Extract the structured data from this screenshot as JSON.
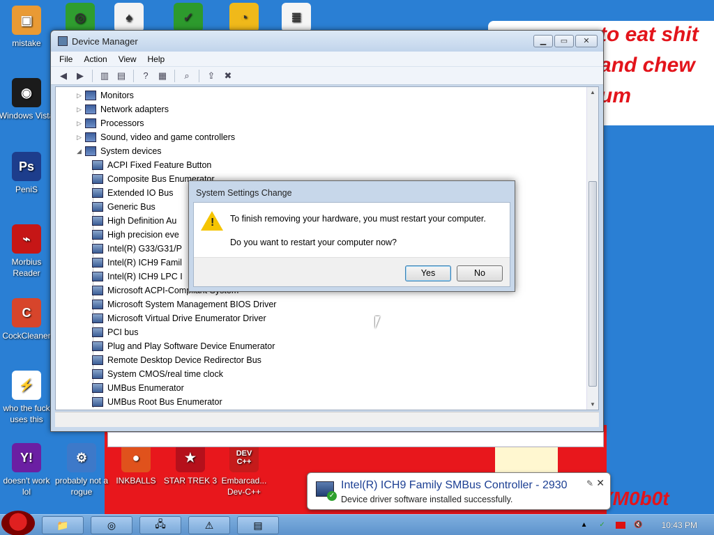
{
  "wallpaper": {
    "graffiti_top": [
      "to eat shit",
      "and chew",
      "um"
    ],
    "graffiti_bottom": "YM0b0t"
  },
  "desktop_icons": [
    {
      "label": "mistake",
      "color": "#e99a34",
      "glyph": "▣"
    },
    {
      "label": "Windows Vista",
      "color": "#1b1b1b",
      "glyph": "◉"
    },
    {
      "label": "PeniS",
      "color": "#1d3d8c",
      "glyph": "Ps"
    },
    {
      "label": "Morbius Reader",
      "color": "#c61616",
      "glyph": "⌁"
    },
    {
      "label": "CockCleaner",
      "color": "#d7452b",
      "glyph": "C"
    },
    {
      "label": "who the fuck uses this",
      "color": "#ffffff",
      "glyph": "⚡"
    },
    {
      "label": "doesn't work lol",
      "color": "#6b1fa3",
      "glyph": "Y!"
    },
    {
      "label": "probably not a rogue",
      "color": "#3d79c9",
      "glyph": "⚙"
    },
    {
      "label": "INKBALLS",
      "color": "#e0521c",
      "glyph": "●"
    },
    {
      "label": "STAR TREK 3",
      "color": "#b5101b",
      "glyph": "★"
    },
    {
      "label": "Embarcad... Dev-C++",
      "color": "#c51b1b",
      "glyph": "DEV C++"
    }
  ],
  "top_icons": [
    {
      "name": "chrome",
      "color": "#2f9d2f",
      "glyph": "◎"
    },
    {
      "name": "solitaire",
      "color": "#f3f3f3",
      "glyph": "♠"
    },
    {
      "name": "shield",
      "color": "#2d9a2d",
      "glyph": "✓"
    },
    {
      "name": "bad-piggies",
      "color": "#f0b91a",
      "glyph": "◔"
    },
    {
      "name": "document",
      "color": "#f5f5f5",
      "glyph": "≣"
    }
  ],
  "device_manager": {
    "title": "Device Manager",
    "menu": [
      "File",
      "Action",
      "View",
      "Help"
    ],
    "tree_top": [
      {
        "label": "Monitors",
        "expanded": false
      },
      {
        "label": "Network adapters",
        "expanded": false
      },
      {
        "label": "Processors",
        "expanded": false
      },
      {
        "label": "Sound, video and game controllers",
        "expanded": false
      },
      {
        "label": "System devices",
        "expanded": true
      }
    ],
    "system_devices": [
      "ACPI Fixed Feature Button",
      "Composite Bus Enumerator",
      "Extended IO Bus",
      "Generic Bus",
      "High Definition Au",
      "High precision eve",
      "Intel(R) G33/G31/P",
      "Intel(R) ICH9 Famil",
      "Intel(R) ICH9 LPC I",
      "Microsoft ACPI-Compliant System",
      "Microsoft System Management BIOS Driver",
      "Microsoft Virtual Drive Enumerator Driver",
      "PCI bus",
      "Plug and Play Software Device Enumerator",
      "Remote Desktop Device Redirector Bus",
      "System CMOS/real time clock",
      "UMBus Enumerator",
      "UMBus Root Bus Enumerator"
    ]
  },
  "dialog": {
    "title": "System Settings Change",
    "message": "To finish removing your hardware, you must restart your computer.",
    "question": "Do you want to restart your computer now?",
    "yes_label": "Yes",
    "no_label": "No"
  },
  "notification": {
    "title": "Intel(R) ICH9 Family SMBus Controller - 2930",
    "text": "Device driver software installed successfully.",
    "close_glyph": "✕",
    "pin_glyph": "✎"
  },
  "taskbar": {
    "buttons": [
      {
        "name": "explorer",
        "glyph": "📁"
      },
      {
        "name": "chrome",
        "glyph": "◎"
      },
      {
        "name": "device-manager",
        "glyph": "🖧"
      },
      {
        "name": "warning",
        "glyph": "⚠"
      },
      {
        "name": "app",
        "glyph": "▤"
      }
    ],
    "clock": "10:43 PM"
  },
  "colors": {
    "desktop": "#2a7fd4",
    "wall_red": "#e8171c",
    "notification_title": "#1c3f93",
    "warning": "#f5c400"
  }
}
